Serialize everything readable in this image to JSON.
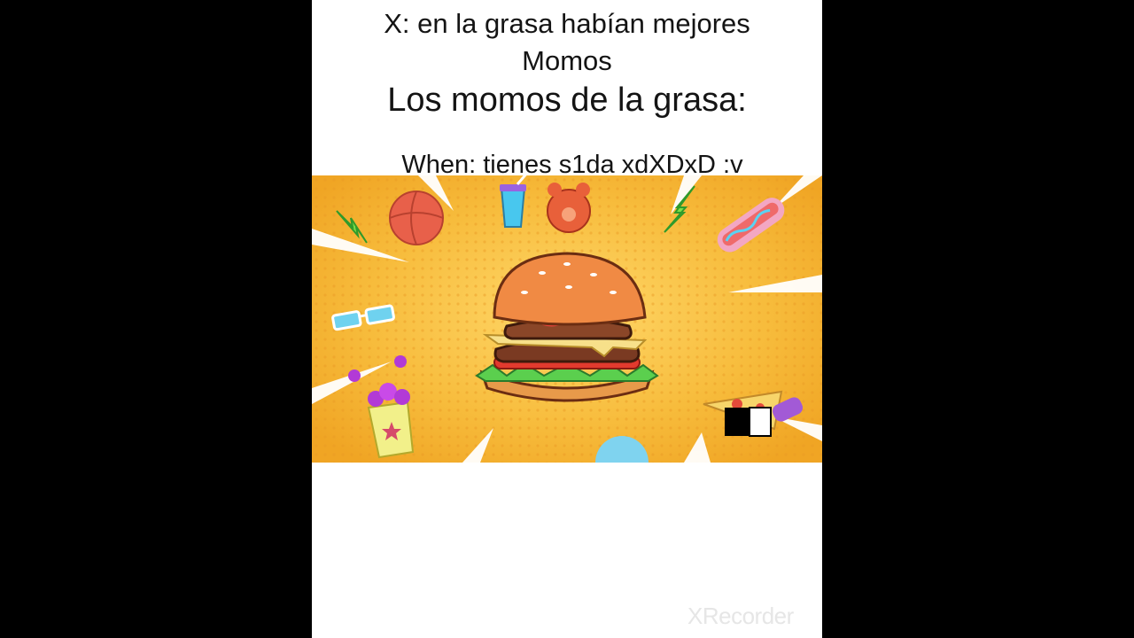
{
  "caption": {
    "line1": "X: en la grasa habían mejores",
    "line2": "Momos",
    "line3": "Los momos de la grasa:",
    "line4": "When: tienes s1da xdXDxD :v"
  },
  "image": {
    "kind": "cartoon-banner",
    "subject": "burger",
    "background_color": "#f6b531"
  },
  "watermark": {
    "text": "XRecorder"
  },
  "colors": {
    "page_background": "#000000",
    "frame_background": "#ffffff",
    "text": "#141414"
  }
}
